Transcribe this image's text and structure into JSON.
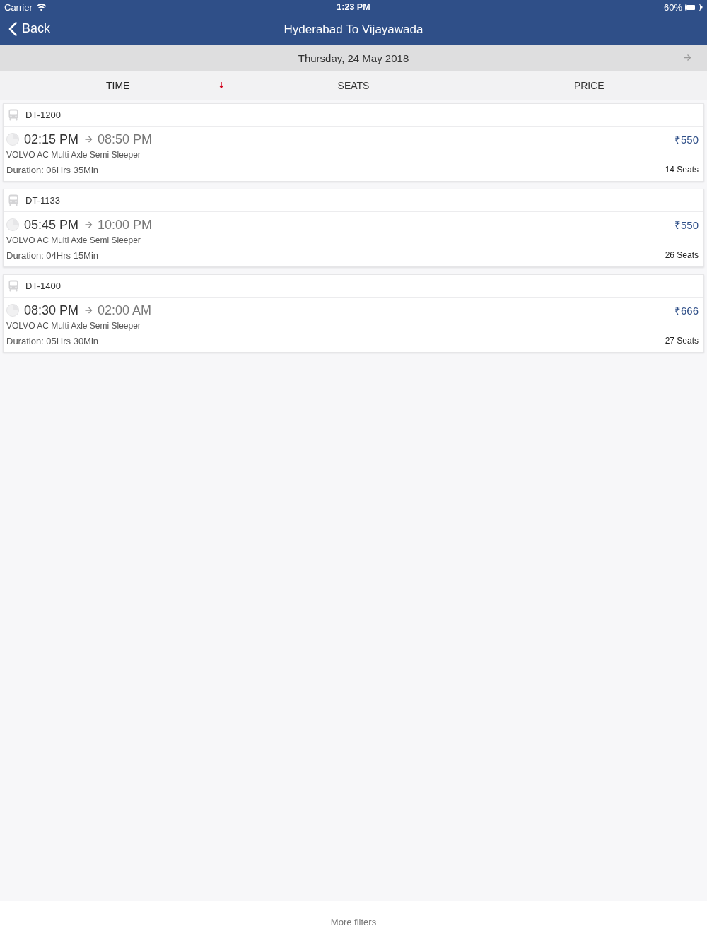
{
  "status_bar": {
    "carrier": "Carrier",
    "time": "1:23 PM",
    "battery": "60%"
  },
  "nav_bar": {
    "back_label": "Back",
    "title": "Hyderabad To Vijayawada"
  },
  "date_bar": {
    "date": "Thursday, 24 May 2018"
  },
  "sort_options": [
    {
      "label": "TIME",
      "selected": true
    },
    {
      "label": "SEATS",
      "selected": false
    },
    {
      "label": "PRICE",
      "selected": false
    }
  ],
  "buses": [
    {
      "code": "DT-1200",
      "departure": "02:15 PM",
      "arrival": "08:50 PM",
      "price": "₹550",
      "bus_type": "VOLVO AC Multi Axle Semi Sleeper",
      "duration": "Duration: 06Hrs 35Min",
      "seats": "14 Seats"
    },
    {
      "code": "DT-1133",
      "departure": "05:45 PM",
      "arrival": "10:00 PM",
      "price": "₹550",
      "bus_type": "VOLVO AC Multi Axle Semi Sleeper",
      "duration": "Duration: 04Hrs 15Min",
      "seats": "26 Seats"
    },
    {
      "code": "DT-1400",
      "departure": "08:30 PM",
      "arrival": "02:00 AM",
      "price": "₹666",
      "bus_type": "VOLVO AC Multi Axle Semi Sleeper",
      "duration": "Duration: 05Hrs 30Min",
      "seats": "27 Seats"
    }
  ],
  "footer": {
    "filters_button": "More filters"
  }
}
